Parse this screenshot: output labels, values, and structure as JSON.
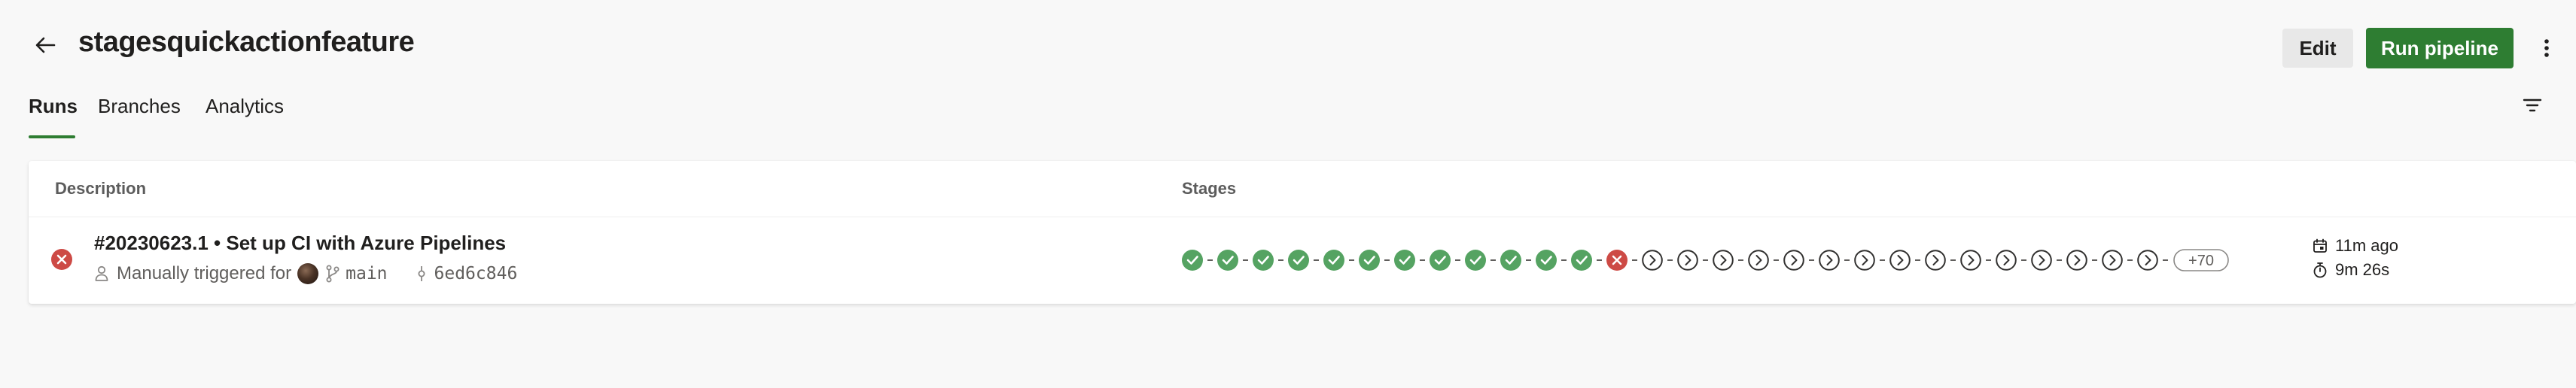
{
  "header": {
    "title": "stagesquickactionfeature",
    "edit_label": "Edit",
    "run_label": "Run pipeline"
  },
  "tabs": [
    {
      "label": "Runs",
      "active": true
    },
    {
      "label": "Branches",
      "active": false
    },
    {
      "label": "Analytics",
      "active": false
    }
  ],
  "table": {
    "columns": {
      "description": "Description",
      "stages": "Stages"
    },
    "run": {
      "status": "failed",
      "title": "#20230623.1 • Set up CI with Azure Pipelines",
      "trigger": "Manually triggered for",
      "branch": "main",
      "commit": "6ed6c846",
      "stages": [
        "succeeded",
        "succeeded",
        "succeeded",
        "succeeded",
        "succeeded",
        "succeeded",
        "succeeded",
        "succeeded",
        "succeeded",
        "succeeded",
        "succeeded",
        "succeeded",
        "failed",
        "notstarted",
        "notstarted",
        "notstarted",
        "notstarted",
        "notstarted",
        "notstarted",
        "notstarted",
        "notstarted",
        "notstarted",
        "notstarted",
        "notstarted",
        "notstarted",
        "notstarted",
        "notstarted",
        "notstarted"
      ],
      "more_stages": "+70",
      "time_ago": "11m ago",
      "duration": "9m 26s"
    }
  },
  "colors": {
    "accent": "#2e7d32",
    "success": "#55a362",
    "failed": "#cd4a45",
    "neutral": "#605e5c"
  }
}
